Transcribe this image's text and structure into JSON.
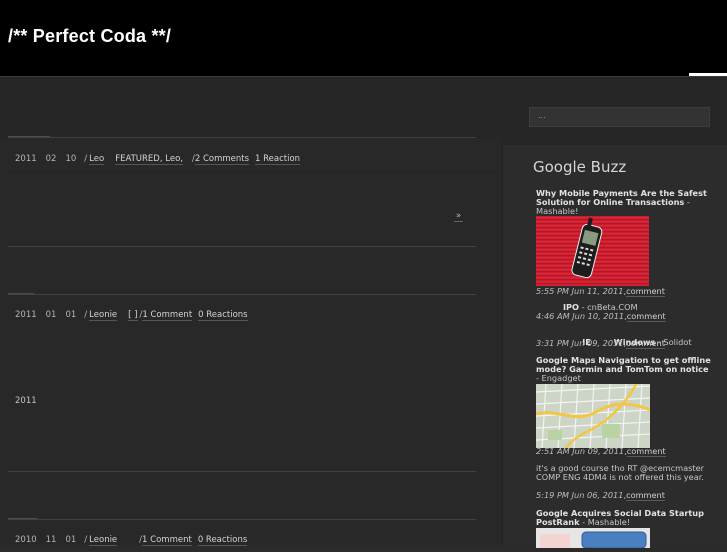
{
  "header": {
    "title": "/** Perfect Coda **/"
  },
  "search": {
    "placeholder": "..."
  },
  "posts": [
    {
      "date": [
        "2011",
        "02",
        "10"
      ],
      "sep": "/",
      "author": "Leo",
      "categories": "FEATURED, Leo,",
      "sep2": "/",
      "comments": "2 Comments",
      "reactions": "1 Reaction",
      "more": "»"
    },
    {
      "date": [
        "2011",
        "01",
        "01"
      ],
      "sep": "/",
      "author": "Leonie",
      "tags": "[  ]",
      "sep2": "/",
      "comments": "1 Comment",
      "reactions": "0 Reactions",
      "body": "2011"
    },
    {
      "date": [
        "2010",
        "11",
        "01"
      ],
      "sep": "/",
      "author": "Leonie",
      "sep2": "/",
      "comments": "1 Comment",
      "reactions": "0 Reactions"
    }
  ],
  "sidebar": {
    "widget_title": "Google Buzz",
    "items": [
      {
        "title": "Why Mobile Payments Are the Safest Solution for Online Transactions",
        "source": " - Mashable!",
        "time": "5:55 PM Jun 11, 2011",
        "sep": ",",
        "comment": "comment"
      },
      {
        "title": "IPO",
        "source": " - cnBeta.COM",
        "time": "4:46 AM Jun 10, 2011",
        "sep": ",",
        "comment": "comment"
      },
      {
        "title": "IE        Windows",
        "source": " - Solidot",
        "time": "3:31 PM Jun 09, 2011",
        "sep": ",",
        "comment": "comment"
      },
      {
        "title": "Google Maps Navigation to get offline mode? Garmin and TomTom on notice",
        "source": " - Engadget",
        "time": "2:51 AM Jun 09, 2011",
        "sep": ",",
        "comment": "comment"
      },
      {
        "text": "it's a good course tho RT @ecemcmaster COMP ENG 4DM4 is not offered this year.",
        "time": "5:19 PM Jun 06, 2011",
        "sep": ",",
        "comment": "comment"
      },
      {
        "title": "Google Acquires Social Data Startup PostRank",
        "source": " - Mashable!"
      }
    ]
  },
  "colors": {
    "header_bg": "#000000",
    "page_bg": "#2b2b2b",
    "thumb_red": "#d0202f"
  }
}
